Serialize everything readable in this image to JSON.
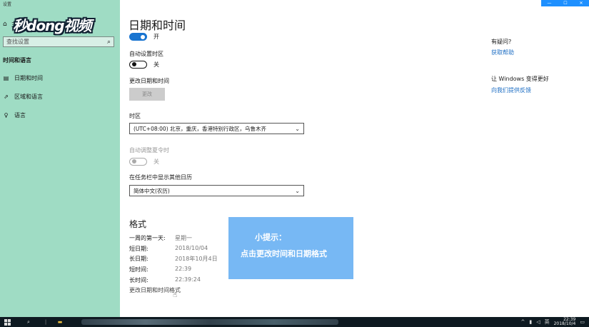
{
  "window": {
    "title": "设置",
    "controls": [
      "—",
      "☐",
      "✕"
    ]
  },
  "sidebar": {
    "home_label": "主页",
    "logo_text": "秒dong视频",
    "search_placeholder": "查找设置",
    "section_heading": "时间和语言",
    "items": [
      {
        "icon": "calendar-icon",
        "label": "日期和时间"
      },
      {
        "icon": "region-icon",
        "label": "区域和语言"
      },
      {
        "icon": "microphone-icon",
        "label": "语言"
      }
    ]
  },
  "main": {
    "title": "日期和时间",
    "auto_time": {
      "state": "开",
      "on": true
    },
    "auto_timezone": {
      "label": "自动设置时区",
      "state": "关",
      "on": false
    },
    "change_datetime": {
      "label": "更改日期和时间",
      "button": "更改"
    },
    "timezone": {
      "label": "时区",
      "value": "(UTC+08:00) 北京，重庆，香港特别行政区，乌鲁木齐"
    },
    "dst": {
      "label": "自动调整夏令时",
      "state": "关",
      "on": false,
      "disabled": true
    },
    "calendar": {
      "label": "在任务栏中显示其他日历",
      "value": "简体中文(农历)"
    },
    "format": {
      "heading": "格式",
      "rows": [
        {
          "key": "一周的第一天:",
          "value": "星期一"
        },
        {
          "key": "短日期:",
          "value": "2018/10/04"
        },
        {
          "key": "长日期:",
          "value": "2018年10月4日"
        },
        {
          "key": "短时间:",
          "value": "22:39"
        },
        {
          "key": "长时间:",
          "value": "22:39:24"
        }
      ],
      "link": "更改日期和时间格式"
    }
  },
  "hint": {
    "title": "小提示：",
    "body": "点击更改时间和日期格式"
  },
  "right": {
    "help_question": "有疑问?",
    "help_link": "获取帮助",
    "improve": "让 Windows 变得更好",
    "feedback_link": "向我们提供反馈"
  },
  "taskbar": {
    "clock_time": "22:39",
    "clock_date": "2018/10/4",
    "tray_text": "英"
  },
  "colors": {
    "sidebar": "#9fdcc4",
    "accent": "#1874d0",
    "hint_bg": "#77b8f4",
    "link": "#1f6fc4",
    "taskbar": "#0e1a21"
  }
}
